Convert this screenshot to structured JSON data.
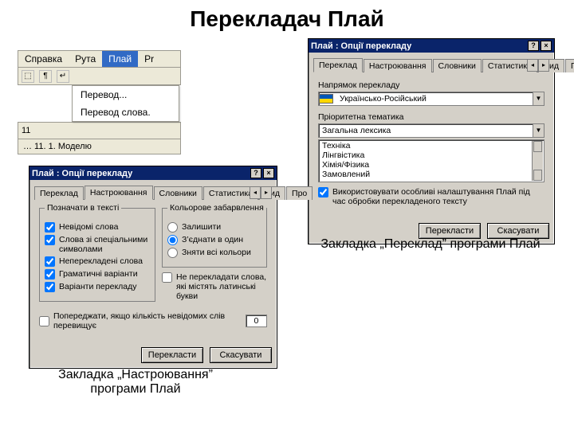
{
  "page_title": "Перекладач Плай",
  "caption_right": "Закладка „Переклад” програми Плай",
  "caption_left": "Закладка „Настроювання” програми Плай",
  "menu_snip": {
    "items": [
      "Справка",
      "Рута",
      "Плай",
      "Pr"
    ],
    "toolbar": {
      "g1": "¶",
      "g2": "⬚",
      "g3": "↵"
    },
    "ruler": "11",
    "dropdown": [
      "Перевод...",
      "Перевод слова."
    ],
    "status": "… 11. 1. Моделю"
  },
  "dlg_right": {
    "title": "Плай : Опції перекладу",
    "tabs": [
      "Переклад",
      "Настроювання",
      "Словники",
      "Статистика",
      "Вид",
      "Про"
    ],
    "active_tab": 0,
    "sect1": "Напрямок перекладу",
    "combo1": "Українсько-Російський",
    "sect2": "Пріоритетна тематика",
    "combo2": "Загальна лексика",
    "list": [
      "Техніка",
      "Лінгвістика",
      "Хімія/Фізика",
      "Замовлений"
    ],
    "chk": "Використовувати особливі налаштування Плай під час обробки перекладеного тексту",
    "btn_ok": "Перекласти",
    "btn_cancel": "Скасувати"
  },
  "dlg_left": {
    "title": "Плай : Опції перекладу",
    "tabs": [
      "Переклад",
      "Настроювання",
      "Словники",
      "Статистика",
      "Вид",
      "Про"
    ],
    "active_tab": 1,
    "group_left": "Позначати в тексті",
    "chk_l": [
      "Невідомі слова",
      "Слова зі спеціальними символами",
      "Неперекладені слова",
      "Граматичні варіанти",
      "Варіанти перекладу"
    ],
    "group_right": "Кольорове забарвлення",
    "rad_r": [
      "Залишити",
      "З’єднати в один",
      "Зняти всі кольори"
    ],
    "chk_r": "Не перекладати слова, які містять латинські букви",
    "chk_warn": "Попереджати, якщо кількість невідомих слів перевищує",
    "warn_val": "0",
    "btn_ok": "Перекласти",
    "btn_cancel": "Скасувати"
  }
}
